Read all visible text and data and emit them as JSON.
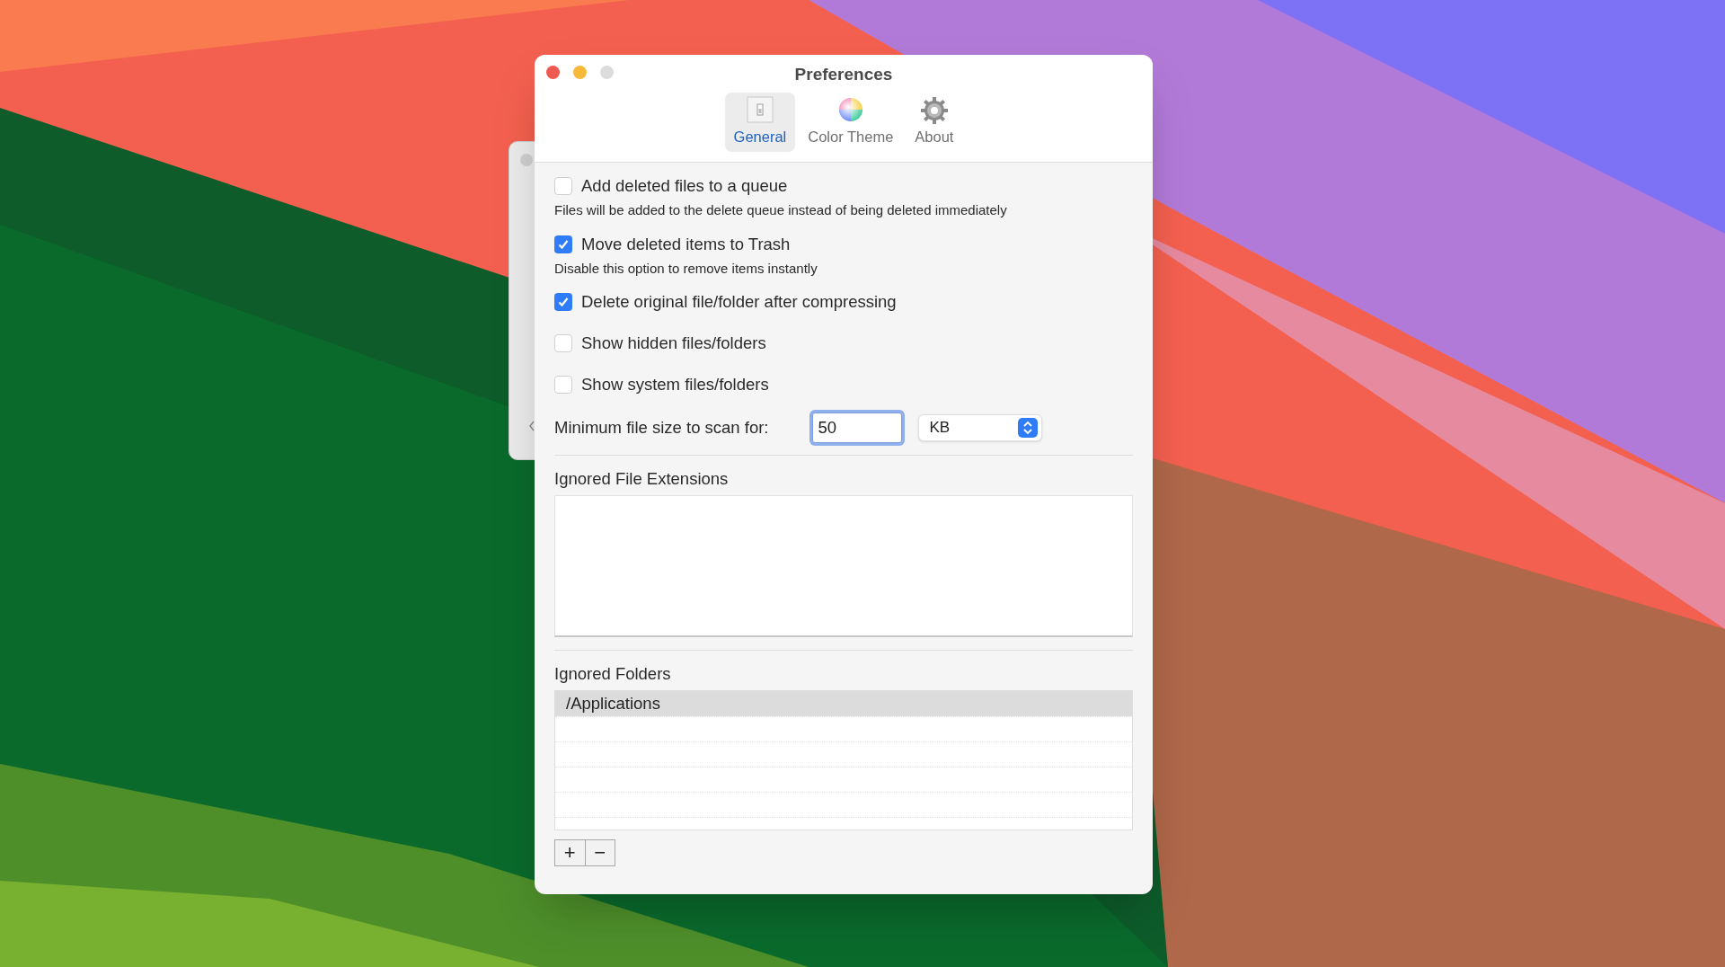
{
  "window": {
    "title": "Preferences"
  },
  "tabs": [
    {
      "label": "General",
      "kind": "switch",
      "selected": true
    },
    {
      "label": "Color Theme",
      "kind": "colorwheel",
      "selected": false
    },
    {
      "label": "About",
      "kind": "gear",
      "selected": false
    }
  ],
  "options": [
    {
      "label": "Add deleted files to a queue",
      "description": "Files will be added to the delete queue instead of being deleted immediately",
      "checked": false
    },
    {
      "label": "Move deleted items to Trash",
      "description": "Disable this option to remove items instantly",
      "checked": true
    },
    {
      "label": "Delete original file/folder after compressing",
      "checked": true
    },
    {
      "label": "Show hidden files/folders",
      "checked": false
    },
    {
      "label": "Show system files/folders",
      "checked": false
    }
  ],
  "min_size": {
    "label": "Minimum file size to scan for:",
    "value": "50",
    "unit": "KB"
  },
  "ignored_extensions": {
    "label": "Ignored File Extensions"
  },
  "ignored_folders": {
    "label": "Ignored Folders",
    "rows": [
      {
        "path": "/Applications",
        "selected": true
      }
    ]
  },
  "list_buttons": [
    "+",
    "−"
  ]
}
